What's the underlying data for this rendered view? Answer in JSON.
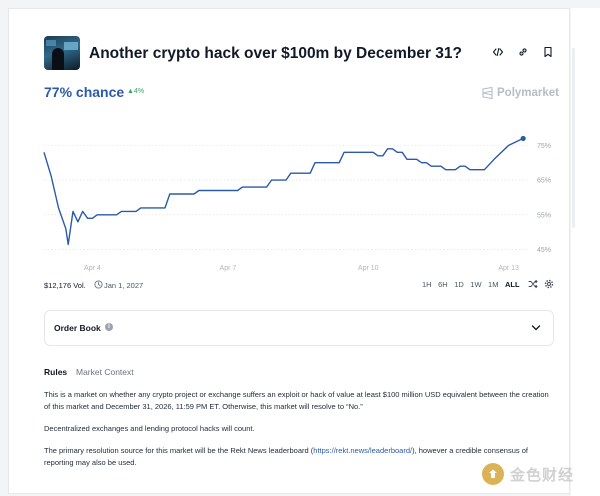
{
  "market": {
    "title": "Another crypto hack over $100m by December 31?",
    "chance": "77% chance",
    "delta": "▲4%",
    "brand": "Polymarket",
    "volume": "$12,176 Vol.",
    "end_date": "Jan 1, 2027"
  },
  "top_actions": [
    "embed-icon",
    "link-icon",
    "bookmark-icon"
  ],
  "ranges": {
    "items": [
      "1H",
      "6H",
      "1D",
      "1W",
      "1M",
      "ALL"
    ],
    "active": "ALL"
  },
  "order_book": {
    "label": "Order Book"
  },
  "tabs": {
    "rules": "Rules",
    "context": "Market Context"
  },
  "rules_text": {
    "p1": "This is a market on whether any crypto project or exchange suffers an exploit or hack of value at least $100 million USD equivalent between the creation of this market and December 31, 2026, 11:59 PM ET. Otherwise, this market will resolve to “No.”",
    "p2": "Decentralized exchanges and lending protocol hacks will count.",
    "p3_before": "The primary resolution source for this market will be the Rekt News leaderboard (",
    "p3_link": "https://rekt.news/leaderboard/",
    "p3_after": "), however a credible consensus of reporting may also be used."
  },
  "watermark": {
    "text": "金色财经"
  },
  "colors": {
    "line": "#2b5aa8",
    "accent": "#2b5aa8",
    "up": "#3aa365"
  },
  "chart_data": {
    "type": "line",
    "x_ticks": [
      "Apr 4",
      "Apr 7",
      "Apr 10",
      "Apr 13"
    ],
    "y_ticks": [
      "75%",
      "65%",
      "55%",
      "45%"
    ],
    "ylim": [
      42,
      80
    ],
    "x_domain": [
      0,
      100
    ],
    "x_tick_positions": [
      10,
      38,
      67,
      96
    ],
    "series": [
      {
        "x": [
          0,
          1.5,
          3,
          4.5,
          5,
          6,
          7,
          8,
          9,
          10,
          11,
          15,
          16,
          19,
          20,
          25,
          26,
          31,
          32,
          40,
          41,
          46,
          47,
          50,
          51,
          55,
          56,
          61,
          62,
          68,
          69,
          70,
          71,
          72,
          73,
          74,
          75,
          77,
          78,
          79,
          80,
          82,
          83,
          85,
          86,
          87,
          88,
          91,
          93,
          96,
          99
        ],
        "y": [
          73,
          66,
          57,
          51,
          46.5,
          56,
          53,
          56,
          54,
          54,
          55,
          55,
          56,
          56,
          57,
          57,
          61,
          61,
          62,
          62,
          63,
          63,
          65,
          65,
          67,
          67,
          70,
          70,
          73,
          73,
          72,
          72,
          74,
          74,
          73,
          73,
          71,
          71,
          70,
          70,
          69,
          69,
          68,
          68,
          69,
          69,
          68,
          68,
          71,
          75,
          77
        ]
      }
    ]
  }
}
